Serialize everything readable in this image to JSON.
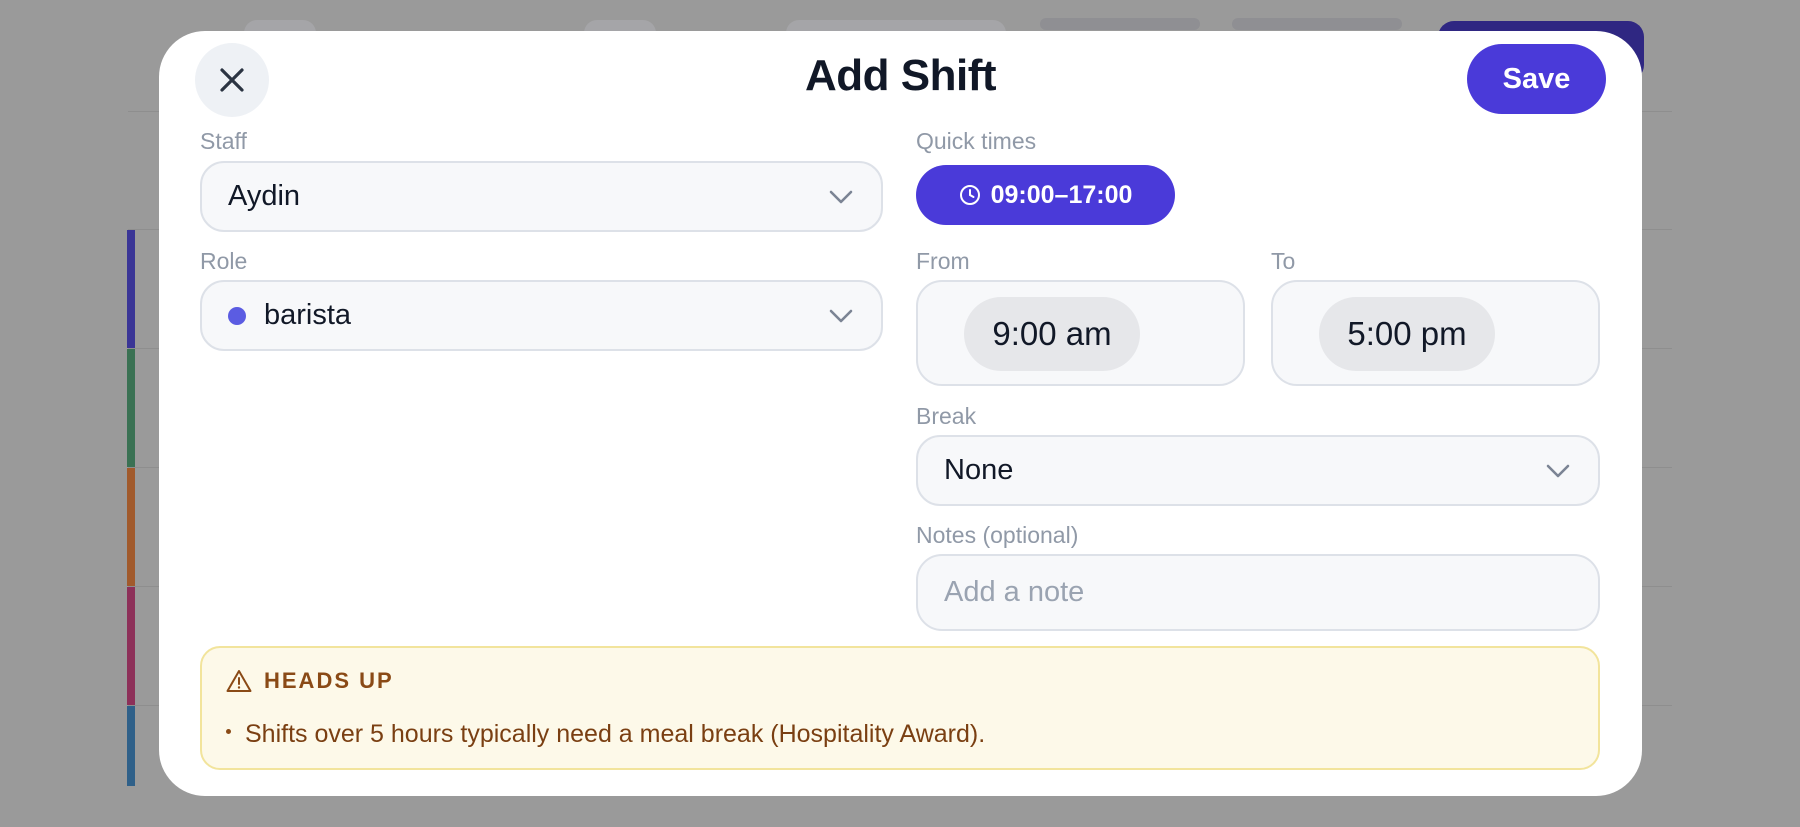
{
  "modal": {
    "title": "Add Shift",
    "close_icon": "close-icon",
    "save_label": "Save"
  },
  "staff": {
    "label": "Staff",
    "value": "Aydin",
    "icon": "chevron-down-icon"
  },
  "role": {
    "label": "Role",
    "value": "barista",
    "dot_color": "#5b5ce2",
    "icon": "chevron-down-icon"
  },
  "quick_times": {
    "label": "Quick times",
    "chip_label": "09:00–17:00",
    "icon": "clock-icon"
  },
  "from": {
    "label": "From",
    "value": "9:00 am"
  },
  "to": {
    "label": "To",
    "value": "5:00 pm"
  },
  "break": {
    "label": "Break",
    "value": "None",
    "icon": "chevron-down-icon"
  },
  "notes": {
    "label": "Notes (optional)",
    "placeholder": "Add a note",
    "value": ""
  },
  "warning": {
    "icon": "warning-triangle-icon",
    "title": "HEADS UP",
    "message": "Shifts over 5 hours typically need a meal break (Hospitality Award)."
  },
  "colors": {
    "accent": "#4a3ad9",
    "warning_bg": "#fdf9e9",
    "warning_text": "#8a4a16"
  }
}
